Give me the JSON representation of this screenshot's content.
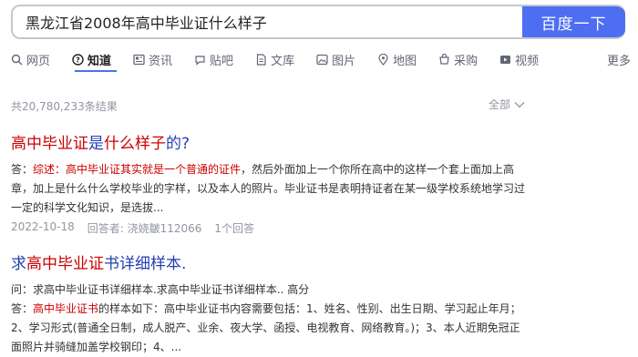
{
  "search": {
    "query": "黑龙江省2008年高中毕业证什么样子",
    "button_label": "百度一下"
  },
  "tabs": [
    {
      "label": "网页",
      "icon": "search-icon"
    },
    {
      "label": "知道",
      "icon": "question-icon"
    },
    {
      "label": "资讯",
      "icon": "news-icon"
    },
    {
      "label": "贴吧",
      "icon": "tieba-icon"
    },
    {
      "label": "文库",
      "icon": "document-icon"
    },
    {
      "label": "图片",
      "icon": "image-icon"
    },
    {
      "label": "地图",
      "icon": "map-icon"
    },
    {
      "label": "采购",
      "icon": "cart-icon"
    },
    {
      "label": "视频",
      "icon": "video-icon"
    },
    {
      "label": "更多",
      "icon": ""
    }
  ],
  "active_tab": "知道",
  "results_info": {
    "count_text": "共20,780,233条结果",
    "filter_label": "全部"
  },
  "results": [
    {
      "title_hl": "高中毕业证",
      "title_mid": "是",
      "title_hl2": "什么样子",
      "title_end": "的?",
      "body_prefix": "答：",
      "body_label": "综述：",
      "body_hl": "高中毕业证其实就是一个普通的证件",
      "body_rest": "，然后外面加上一个你所在高中的这样一个套上面加上高章，加上是什么什么学校毕业的字样，以及本人的照片。毕业证书是表明持证者在某一级学校系统地学习过一定的科学文化知识，是选拔...",
      "date": "2022-10-18",
      "answerer": "回答者: 浇娆皺112066",
      "answers": "1个回答"
    },
    {
      "title_prefix": "求",
      "title_hl": "高中毕业证",
      "title_rest": "书详细样本.",
      "question": "问：求高中毕业证书详细样本.求高中毕业证书详细样本.. 高分",
      "body_prefix": "答：",
      "body_hl": "高中毕业证书",
      "body_rest": "的样本如下：高中毕业证书内容需要包括：1、姓名、性别、出生日期、学习起止年月；2、学习形式(普通全日制，成人脱产、业余、夜大学、函授、电视教育、网络教育。)；3、本人近期免冠正面照片并骑缝加盖学校钢印；4、..."
    }
  ],
  "colors": {
    "accent": "#4e6ef2",
    "link": "#2440b3",
    "highlight": "#cc0000",
    "muted": "#9195a3"
  }
}
